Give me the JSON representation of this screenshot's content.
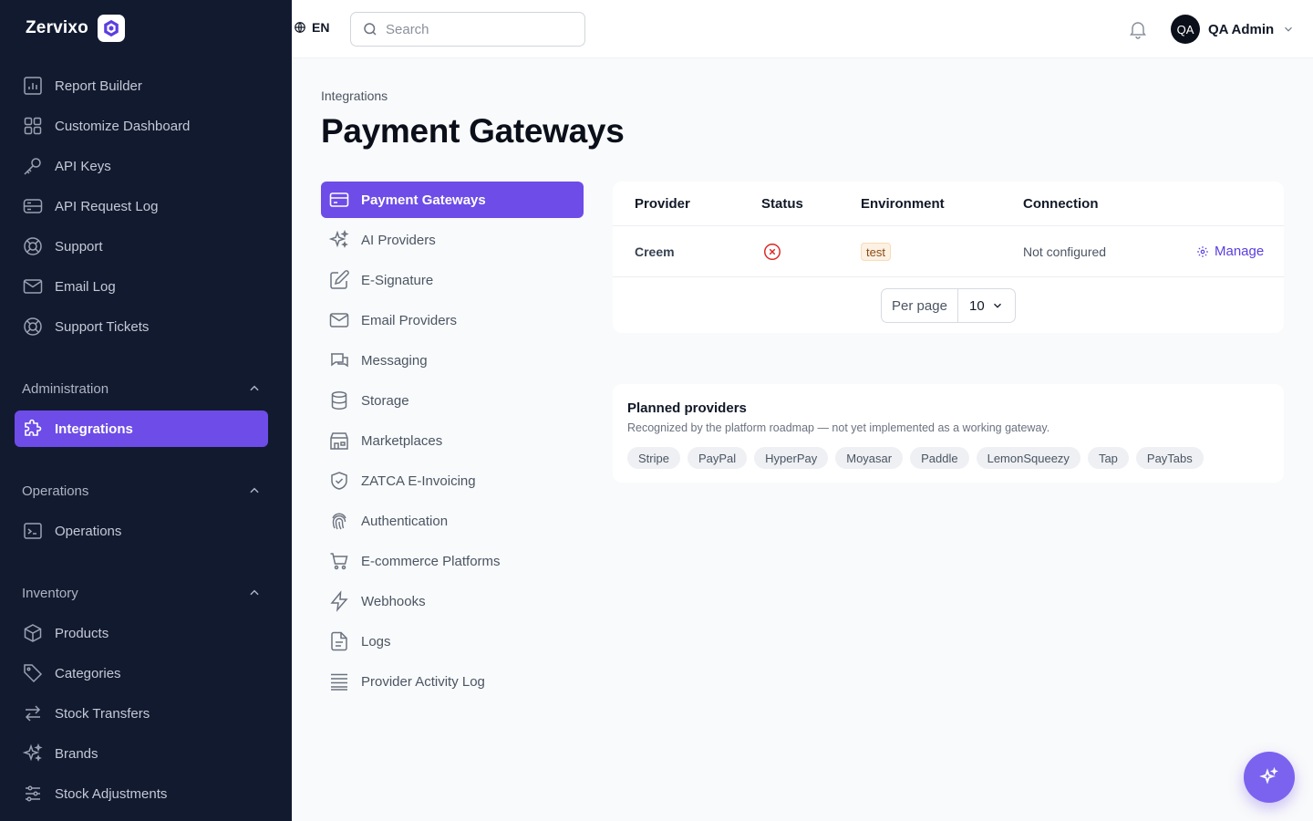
{
  "app": {
    "name": "Zervixo"
  },
  "topbar": {
    "lang": "EN",
    "search_placeholder": "Search",
    "user_initials": "QA",
    "user_name": "QA Admin"
  },
  "sidebar": {
    "items": [
      {
        "label": "Report Builder",
        "icon": "chart-icon"
      },
      {
        "label": "Customize Dashboard",
        "icon": "grid-icon"
      },
      {
        "label": "API Keys",
        "icon": "key-icon"
      },
      {
        "label": "API Request Log",
        "icon": "server-icon"
      },
      {
        "label": "Support",
        "icon": "lifebuoy-icon"
      },
      {
        "label": "Email Log",
        "icon": "mail-icon"
      },
      {
        "label": "Support Tickets",
        "icon": "lifebuoy-icon"
      }
    ],
    "sections": {
      "administration": {
        "title": "Administration",
        "items": [
          {
            "label": "Integrations",
            "icon": "puzzle-icon"
          }
        ]
      },
      "operations": {
        "title": "Operations",
        "items": [
          {
            "label": "Operations",
            "icon": "terminal-icon"
          }
        ]
      },
      "inventory": {
        "title": "Inventory",
        "items": [
          {
            "label": "Products",
            "icon": "box-icon"
          },
          {
            "label": "Categories",
            "icon": "tag-icon"
          },
          {
            "label": "Stock Transfers",
            "icon": "arrows-icon"
          },
          {
            "label": "Brands",
            "icon": "sparkles-icon"
          },
          {
            "label": "Stock Adjustments",
            "icon": "sliders-icon"
          }
        ]
      }
    }
  },
  "main": {
    "breadcrumb": "Integrations",
    "title": "Payment Gateways",
    "subnav": [
      {
        "label": "Payment Gateways",
        "icon": "credit-card-icon"
      },
      {
        "label": "AI Providers",
        "icon": "sparkles-icon"
      },
      {
        "label": "E-Signature",
        "icon": "pen-icon"
      },
      {
        "label": "Email Providers",
        "icon": "mail-icon"
      },
      {
        "label": "Messaging",
        "icon": "chat-icon"
      },
      {
        "label": "Storage",
        "icon": "database-icon"
      },
      {
        "label": "Marketplaces",
        "icon": "store-icon"
      },
      {
        "label": "ZATCA E-Invoicing",
        "icon": "shield-check-icon"
      },
      {
        "label": "Authentication",
        "icon": "fingerprint-icon"
      },
      {
        "label": "E-commerce Platforms",
        "icon": "cart-icon"
      },
      {
        "label": "Webhooks",
        "icon": "bolt-icon"
      },
      {
        "label": "Logs",
        "icon": "file-icon"
      },
      {
        "label": "Provider Activity Log",
        "icon": "list-icon"
      }
    ],
    "table": {
      "headers": [
        "Provider",
        "Status",
        "Environment",
        "Connection"
      ],
      "rows": [
        {
          "provider": "Creem",
          "status": "error",
          "environment": "test",
          "connection": "Not configured",
          "action": "Manage"
        }
      ],
      "per_page_label": "Per page",
      "per_page_value": "10"
    },
    "planned": {
      "title": "Planned providers",
      "subtitle": "Recognized by the platform roadmap — not yet implemented as a working gateway.",
      "chips": [
        "Stripe",
        "PayPal",
        "HyperPay",
        "Moyasar",
        "Paddle",
        "LemonSqueezy",
        "Tap",
        "PayTabs"
      ]
    }
  },
  "colors": {
    "sidebar_bg": "#121a30",
    "accent": "#6d4ce8",
    "status_error": "#dc2626"
  }
}
